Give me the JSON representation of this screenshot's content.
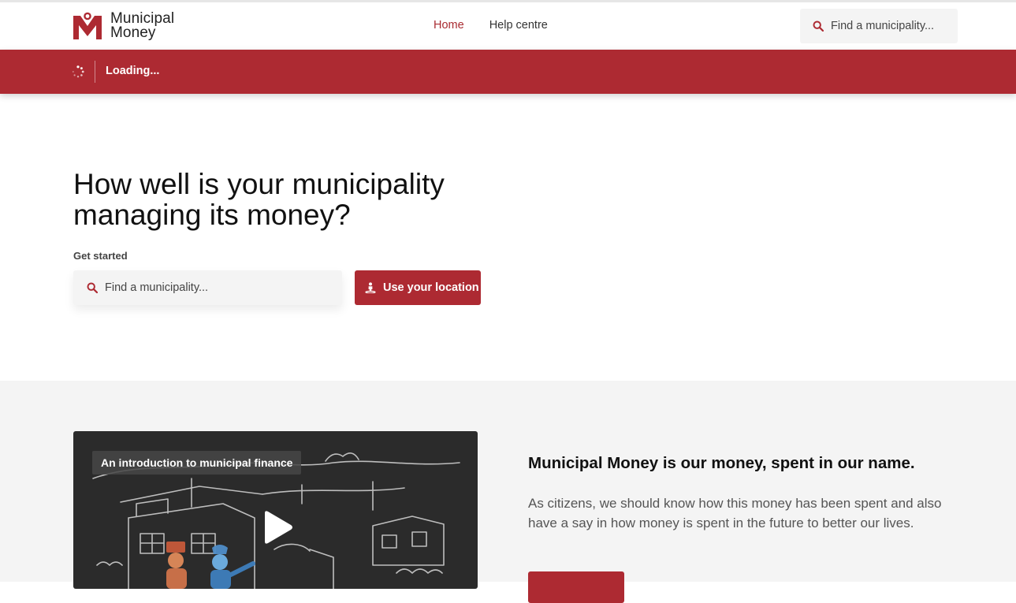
{
  "brand": {
    "name_line1": "Municipal",
    "name_line2": "Money",
    "accent_color": "#ad2a32"
  },
  "nav": {
    "links": [
      {
        "label": "Home",
        "active": true
      },
      {
        "label": "Help centre",
        "active": false
      }
    ],
    "search_placeholder": "Find a municipality..."
  },
  "banner": {
    "spinner_icon": "loading-spinner-icon",
    "text": "Loading..."
  },
  "hero": {
    "title": "How well is your municipality managing its money?",
    "get_started": "Get started",
    "search_placeholder": "Find a municipality...",
    "location_button": "Use your location"
  },
  "intro": {
    "video_title": "An introduction to municipal finance",
    "video_icon": "play-icon",
    "heading": "Municipal Money is our money, spent in our name.",
    "body": "As citizens, we should know how this money has been spent and also have a say in how money is spent in the future to better our lives."
  }
}
